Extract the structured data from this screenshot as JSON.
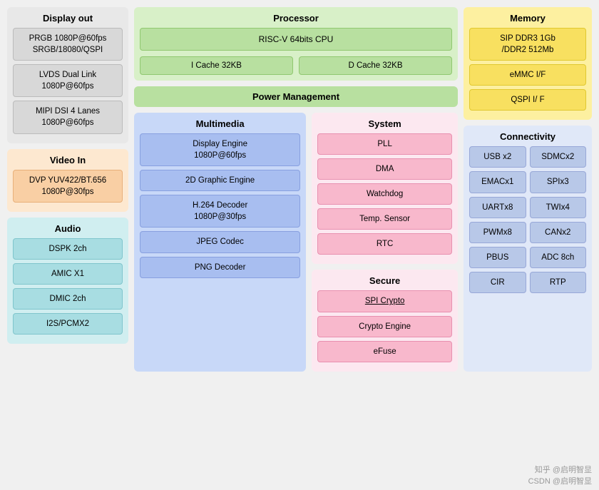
{
  "display_out": {
    "title": "Display out",
    "boxes": [
      "PRGB 1080P@60fps\nSRGB/18080/QSPI",
      "LVDS Dual Link\n1080P@60fps",
      "MIPI DSI 4 Lanes\n1080P@60fps"
    ]
  },
  "video_in": {
    "title": "Video In",
    "boxes": [
      "DVP YUV422/BT.656\n1080P@30fps"
    ]
  },
  "audio": {
    "title": "Audio",
    "boxes": [
      "DSPK 2ch",
      "AMIC X1",
      "DMIC 2ch",
      "I2S/PCMX2"
    ]
  },
  "processor": {
    "title": "Processor",
    "cpu": "RISC-V 64bits CPU",
    "icache": "I   Cache 32KB",
    "dcache": "D Cache 32KB"
  },
  "power_mgmt": {
    "title": "Power Management"
  },
  "multimedia": {
    "title": "Multimedia",
    "boxes": [
      "Display Engine\n1080P@60fps",
      "2D Graphic Engine",
      "H.264 Decoder\n1080P@30fps",
      "JPEG Codec",
      "PNG Decoder"
    ]
  },
  "system": {
    "title": "System",
    "boxes": [
      "PLL",
      "DMA",
      "Watchdog",
      "Temp. Sensor",
      "RTC"
    ]
  },
  "secure": {
    "title": "Secure",
    "boxes": [
      "SPI Crypto",
      "Crypto Engine",
      "eFuse"
    ]
  },
  "memory": {
    "title": "Memory",
    "boxes": [
      "SIP DDR3 1Gb\n/DDR2 512Mb",
      "eMMC I/F",
      "QSPI I/ F"
    ]
  },
  "connectivity": {
    "title": "Connectivity",
    "items": [
      "USB x2",
      "SDMCx2",
      "EMACx1",
      "SPIx3",
      "UARTx8",
      "TWIx4",
      "PWMx8",
      "CANx2",
      "PBUS",
      "ADC 8ch",
      "CIR",
      "RTP"
    ]
  },
  "watermark": {
    "line1": "知乎 @启明智显",
    "line2": "CSDN @启明智显"
  }
}
